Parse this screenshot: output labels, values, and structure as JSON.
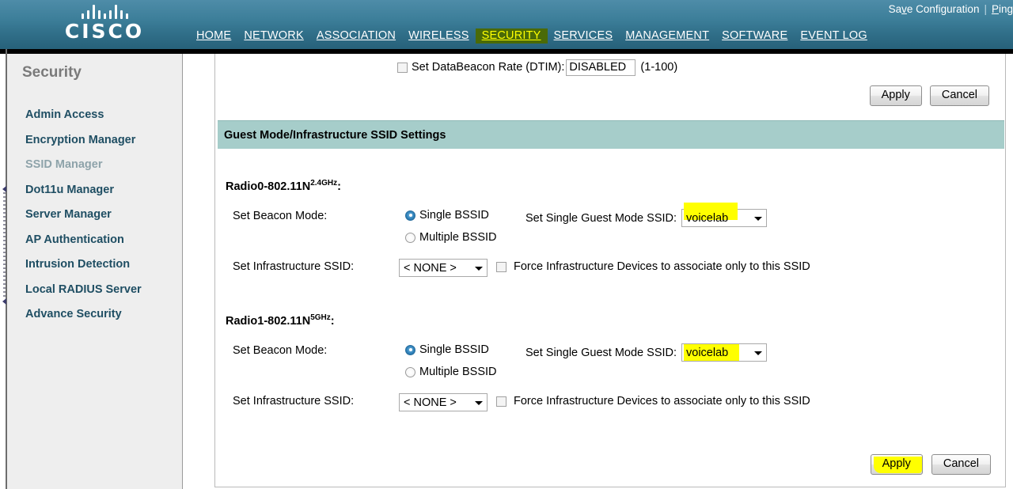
{
  "banner": {
    "logo_text": "CISCO",
    "logo_icon": "cisco-bars-logo",
    "util_links": [
      {
        "label": "Save Configuration",
        "accesskey": "v"
      },
      {
        "label": "Ping",
        "accesskey": "P"
      }
    ],
    "separator": "|",
    "nav": [
      {
        "label": "HOME",
        "active": false
      },
      {
        "label": "NETWORK",
        "active": false
      },
      {
        "label": "ASSOCIATION",
        "active": false
      },
      {
        "label": "WIRELESS",
        "active": false
      },
      {
        "label": "SECURITY",
        "active": true
      },
      {
        "label": "SERVICES",
        "active": false
      },
      {
        "label": "MANAGEMENT",
        "active": false
      },
      {
        "label": "SOFTWARE",
        "active": false
      },
      {
        "label": "EVENT LOG",
        "active": false
      }
    ],
    "active_bg": "#4a6a07",
    "active_fg": "#ffff00"
  },
  "sidebar": {
    "title": "Security",
    "items": [
      {
        "label": "Admin Access",
        "current": false
      },
      {
        "label": "Encryption Manager",
        "current": false
      },
      {
        "label": "SSID Manager",
        "current": true
      },
      {
        "label": "Dot11u Manager",
        "current": false
      },
      {
        "label": "Server Manager",
        "current": false
      },
      {
        "label": "AP Authentication",
        "current": false
      },
      {
        "label": "Intrusion Detection",
        "current": false
      },
      {
        "label": "Local RADIUS Server",
        "current": false
      },
      {
        "label": "Advance Security",
        "current": false
      }
    ]
  },
  "content": {
    "dtim": {
      "checkbox_checked": false,
      "label": "Set DataBeacon Rate (DTIM):",
      "value": "DISABLED",
      "range_hint": "(1-100)"
    },
    "top_buttons": {
      "apply": "Apply",
      "cancel": "Cancel"
    },
    "section_header": "Guest Mode/Infrastructure SSID Settings",
    "radios": [
      {
        "heading_main": "Radio0-802.11N",
        "heading_sup": "2.4GHz",
        "heading_suffix": ":",
        "beacon_mode_label": "Set Beacon Mode:",
        "beacon_options": [
          {
            "label": "Single BSSID",
            "selected": true
          },
          {
            "label": "Multiple BSSID",
            "selected": false
          }
        ],
        "guest_ssid_label": "Set Single Guest Mode SSID:",
        "guest_ssid_value": "voicelab",
        "guest_ssid_highlighted": true,
        "infra_ssid_label": "Set Infrastructure SSID:",
        "infra_ssid_value": "< NONE >",
        "force_label": "Force Infrastructure Devices to associate only to this SSID",
        "force_checked": false
      },
      {
        "heading_main": "Radio1-802.11N",
        "heading_sup": "5GHz",
        "heading_suffix": ":",
        "beacon_mode_label": "Set Beacon Mode:",
        "beacon_options": [
          {
            "label": "Single BSSID",
            "selected": true
          },
          {
            "label": "Multiple BSSID",
            "selected": false
          }
        ],
        "guest_ssid_label": "Set Single Guest Mode SSID:",
        "guest_ssid_value": "voicelab",
        "guest_ssid_highlighted": true,
        "infra_ssid_label": "Set Infrastructure SSID:",
        "infra_ssid_value": "< NONE >",
        "force_label": "Force Infrastructure Devices to associate only to this SSID",
        "force_checked": false
      }
    ],
    "bottom_buttons": {
      "apply": "Apply",
      "apply_highlighted": true,
      "cancel": "Cancel"
    }
  },
  "colors": {
    "banner_top": "#4e8ca8",
    "banner_bottom": "#27617a",
    "section_header_bg": "#a6cdca",
    "sidebar_bg": "#eeeeee",
    "sidebar_link": "#1f4e63",
    "sidebar_current": "#8ea3aa",
    "highlight_yellow": "#ffff00"
  }
}
